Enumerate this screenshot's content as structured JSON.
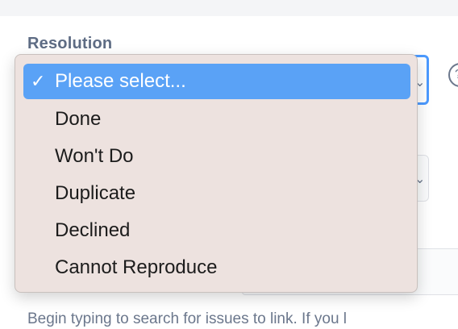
{
  "form": {
    "resolution_label": "Resolution",
    "help_text": "Begin typing to search for issues to link. If you l"
  },
  "dropdown": {
    "selected_index": 0,
    "check_glyph": "✓",
    "options": [
      "Please select...",
      "Done",
      "Won't Do",
      "Duplicate",
      "Declined",
      "Cannot Reproduce"
    ]
  },
  "icons": {
    "chevron": "chevron-down-icon",
    "help": "help-circle-icon",
    "check": "checkmark-icon"
  },
  "colors": {
    "highlight": "#5aa2f6",
    "menu_background": "#ede2df",
    "focus_border": "#4c9aff",
    "label_text": "#5e6c84"
  }
}
